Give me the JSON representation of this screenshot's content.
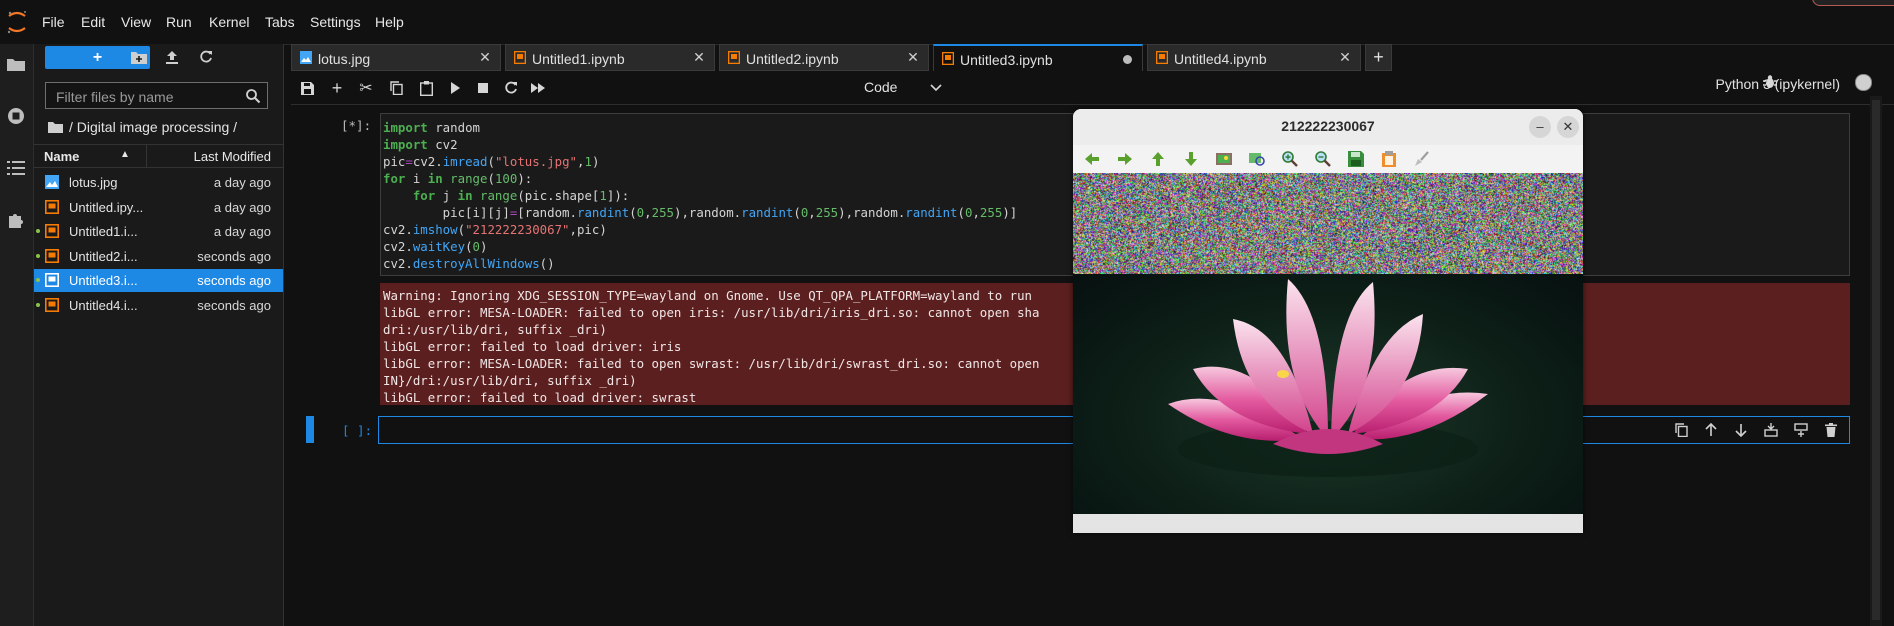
{
  "menu": {
    "items": [
      "File",
      "Edit",
      "View",
      "Run",
      "Kernel",
      "Tabs",
      "Settings",
      "Help"
    ]
  },
  "filebrowser": {
    "filter_placeholder": "Filter files by name",
    "breadcrumb": "/ Digital image processing /",
    "col_name": "Name",
    "col_modified": "Last Modified",
    "files": [
      {
        "name": "lotus.jpg",
        "modified": "a day ago",
        "type": "image",
        "running": false,
        "selected": false
      },
      {
        "name": "Untitled.ipy...",
        "modified": "a day ago",
        "type": "notebook",
        "running": false,
        "selected": false
      },
      {
        "name": "Untitled1.i...",
        "modified": "a day ago",
        "type": "notebook",
        "running": true,
        "selected": false
      },
      {
        "name": "Untitled2.i...",
        "modified": "seconds ago",
        "type": "notebook",
        "running": true,
        "selected": false
      },
      {
        "name": "Untitled3.i...",
        "modified": "seconds ago",
        "type": "notebook",
        "running": true,
        "selected": true
      },
      {
        "name": "Untitled4.i...",
        "modified": "seconds ago",
        "type": "notebook",
        "running": true,
        "selected": false
      }
    ]
  },
  "tabs": [
    {
      "label": "lotus.jpg",
      "type": "image",
      "active": false,
      "dirty": false
    },
    {
      "label": "Untitled1.ipynb",
      "type": "notebook",
      "active": false,
      "dirty": false
    },
    {
      "label": "Untitled2.ipynb",
      "type": "notebook",
      "active": false,
      "dirty": false
    },
    {
      "label": "Untitled3.ipynb",
      "type": "notebook",
      "active": true,
      "dirty": true
    },
    {
      "label": "Untitled4.ipynb",
      "type": "notebook",
      "active": false,
      "dirty": false
    }
  ],
  "toolbar": {
    "cell_type": "Code",
    "kernel_name": "Python 3 (ipykernel)"
  },
  "cell1": {
    "prompt": "[*]:",
    "output_lines": [
      "Warning: Ignoring XDG_SESSION_TYPE=wayland on Gnome. Use QT_QPA_PLATFORM=wayland to run",
      "libGL error: MESA-LOADER: failed to open iris: /usr/lib/dri/iris_dri.so: cannot open sha                                 /x86_64-linux-gnu/dri:\\${ORIGIN}/",
      "dri:/usr/lib/dri, suffix _dri)",
      "libGL error: failed to load driver: iris",
      "libGL error: MESA-LOADER: failed to open swrast: /usr/lib/dri/swrast_dri.so: cannot open                                 /lib/x86_64-linux-gnu/dri:\\${ORIG",
      "IN}/dri:/usr/lib/dri, suffix _dri)",
      "libGL error: failed to load driver: swrast"
    ]
  },
  "cell2": {
    "prompt": "[ ]:"
  },
  "image_window": {
    "title": "212222230067"
  },
  "colors": {
    "accent": "#1e88e5",
    "error_bg": "#5b1f1f",
    "running_dot": "#8bc34a",
    "notebook_icon": "#f57c00"
  }
}
